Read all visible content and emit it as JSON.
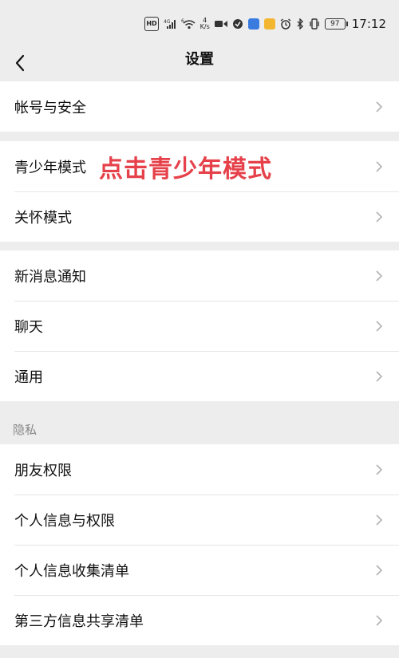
{
  "status_bar": {
    "hd": "HD",
    "net1": "4G",
    "wifi_tag": "6",
    "speed_value": "4",
    "speed_unit": "K/s",
    "battery": "97",
    "time": "17:12"
  },
  "nav": {
    "title": "设置"
  },
  "groups": [
    {
      "items": [
        {
          "label": "帐号与安全"
        }
      ]
    },
    {
      "items": [
        {
          "label": "青少年模式",
          "annotation": "点击青少年模式"
        },
        {
          "label": "关怀模式"
        }
      ]
    },
    {
      "items": [
        {
          "label": "新消息通知"
        },
        {
          "label": "聊天"
        },
        {
          "label": "通用"
        }
      ]
    },
    {
      "header": "隐私",
      "items": [
        {
          "label": "朋友权限"
        },
        {
          "label": "个人信息与权限"
        },
        {
          "label": "个人信息收集清单"
        },
        {
          "label": "第三方信息共享清单"
        }
      ]
    }
  ],
  "colors": {
    "background": "#ededed",
    "row_background": "#ffffff",
    "annotation": "#e6414a",
    "chevron": "#b2b2b2"
  }
}
